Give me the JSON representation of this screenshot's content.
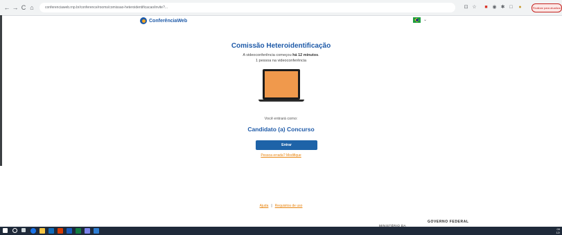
{
  "browser": {
    "back_glyph": "←",
    "forward_glyph": "→",
    "reload_glyph": "C",
    "home_glyph": "⌂",
    "url": "conferenciaweb.rnp.br/conference/rooms/comissao-heteroidentificacao/invite?...",
    "extension_glyphs": [
      "⊡",
      "☆",
      "■",
      "◉",
      "✱",
      "□",
      "●"
    ],
    "finish_button_label": "Finalizar para atualizar"
  },
  "header": {
    "logo_text": "ConferênciaWeb",
    "language_caret": "⌄",
    "brand_color": "#1e5aa8"
  },
  "room": {
    "title": "Comissão Heteroidentificação",
    "started_prefix": "A videoconferência começou ",
    "started_duration": "há 12 minutos",
    "started_suffix": ".",
    "participants": "1 pessoa na videoconferência"
  },
  "join": {
    "you_enter_as": "Você entrará como:",
    "participant_name": "Candidato (a) Concurso",
    "enter_button_label": "Entrar",
    "modify_link": "Pessoa errada? Modifique"
  },
  "footer": {
    "help": "Ajuda",
    "separator": "|",
    "terms": "Requisitos de uso",
    "gov_label": "GOVERNO FEDERAL",
    "ministry_label": "MINISTÉRIO DA"
  },
  "taskbar": {
    "clock_time": "09",
    "clock_date": "12/"
  }
}
